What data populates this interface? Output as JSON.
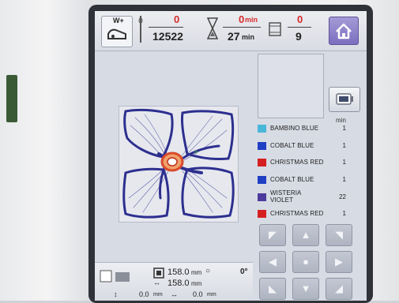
{
  "header": {
    "presser_foot_label": "W+",
    "stitch_current": "0",
    "stitch_total": "12522",
    "time_current": "0",
    "time_total": "27",
    "time_unit": "min",
    "color_current": "0",
    "color_total": "9"
  },
  "color_list": {
    "min_header": "min",
    "items": [
      {
        "name": "BAMBINO BLUE",
        "minutes": "1",
        "color": "#49b7d8"
      },
      {
        "name": "COBALT BLUE",
        "minutes": "1",
        "color": "#1f3fc4"
      },
      {
        "name": "CHRISTMAS RED",
        "minutes": "1",
        "color": "#d42020"
      },
      {
        "name": "COBALT BLUE",
        "minutes": "1",
        "color": "#1f3fc4"
      },
      {
        "name": "WISTERIA VIOLET",
        "minutes": "22",
        "color": "#4d3b9c"
      },
      {
        "name": "CHRISTMAS RED",
        "minutes": "1",
        "color": "#d42020"
      }
    ]
  },
  "footer": {
    "width_value": "158.0",
    "height_value": "158.0",
    "size_unit": "mm",
    "angle_value": "0°",
    "offset_x": "0.0",
    "offset_y": "0.0",
    "offset_unit": "mm"
  },
  "icons": {
    "home": "home-icon",
    "camera": "camera-icon",
    "presser_foot": "presser-foot-icon",
    "needle": "needle-icon",
    "hourglass": "hourglass-icon",
    "thread_spool": "thread-spool-icon"
  }
}
